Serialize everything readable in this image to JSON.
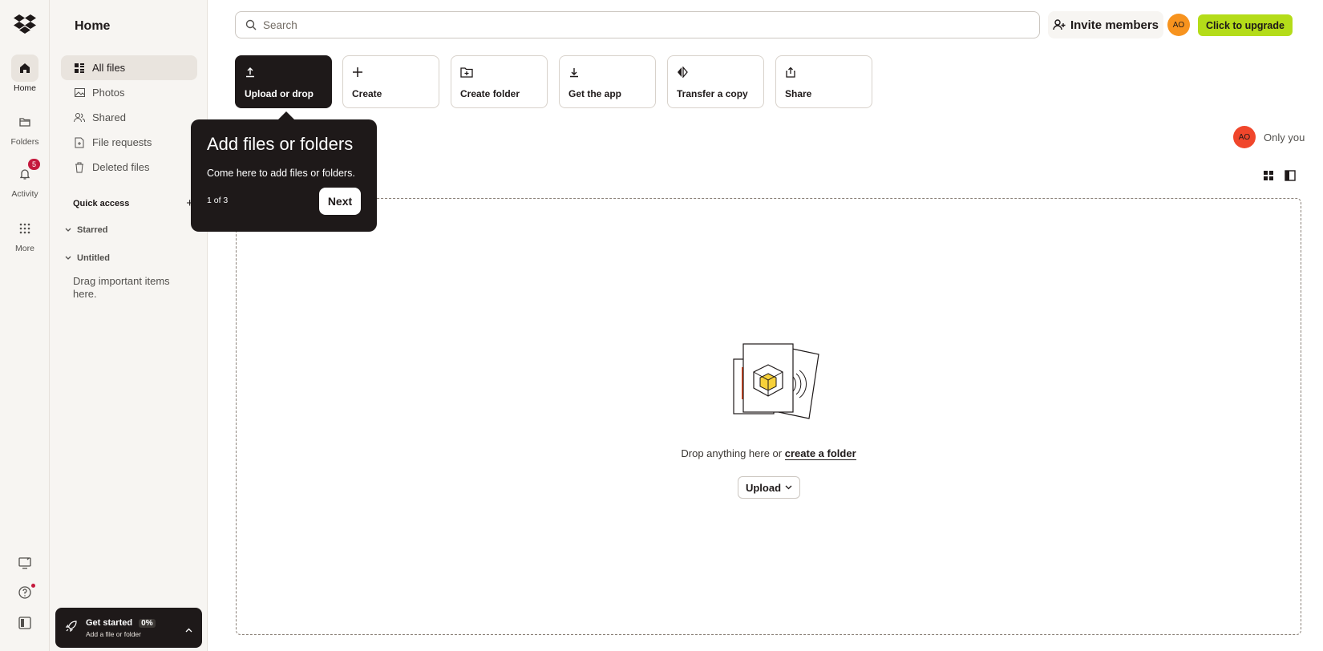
{
  "rail": {
    "items": [
      {
        "label": "Home",
        "icon": "home-icon"
      },
      {
        "label": "Folders",
        "icon": "folder-icon"
      },
      {
        "label": "Activity",
        "icon": "bell-icon",
        "badge": "5"
      },
      {
        "label": "More",
        "icon": "grid-icon"
      }
    ],
    "bottom_icons": [
      "monitor-icon",
      "help-icon",
      "panel-icon"
    ]
  },
  "nav": {
    "title": "Home",
    "items": [
      {
        "label": "All files",
        "icon": "all-files-icon",
        "active": true
      },
      {
        "label": "Photos",
        "icon": "photo-icon"
      },
      {
        "label": "Shared",
        "icon": "people-icon"
      },
      {
        "label": "File requests",
        "icon": "file-request-icon"
      },
      {
        "label": "Deleted files",
        "icon": "trash-icon"
      }
    ],
    "quick_access": "Quick access",
    "starred": "Starred",
    "untitled": "Untitled",
    "drag_hint": "Drag important items here."
  },
  "get_started": {
    "title": "Get started",
    "percent": "0%",
    "subtitle": "Add a file or folder",
    "progress": 0
  },
  "search": {
    "placeholder": "Search"
  },
  "header": {
    "invite": "Invite members",
    "avatar_initials": "AO",
    "upgrade": "Click to upgrade"
  },
  "actions": [
    {
      "label": "Upload or drop",
      "icon": "upload-icon"
    },
    {
      "label": "Create",
      "icon": "plus-icon"
    },
    {
      "label": "Create folder",
      "icon": "folder-plus-icon"
    },
    {
      "label": "Get the app",
      "icon": "download-icon"
    },
    {
      "label": "Transfer a copy",
      "icon": "transfer-icon"
    },
    {
      "label": "Share",
      "icon": "share-icon"
    }
  ],
  "tooltip": {
    "title": "Add files or folders",
    "body": "Come here to add files or folders.",
    "step": "1 of 3",
    "next": "Next"
  },
  "sharing": {
    "avatar_initials": "AO",
    "label": "Only you"
  },
  "dropzone": {
    "text": "Drop anything here or",
    "link": "create a folder",
    "upload": "Upload"
  },
  "colors": {
    "brand": "#0061fe",
    "upgrade": "#b4dc19",
    "dark": "#1e1919",
    "badge": "#c4183c",
    "avatar_orange": "#f7931e",
    "avatar_red": "#f0462b"
  }
}
